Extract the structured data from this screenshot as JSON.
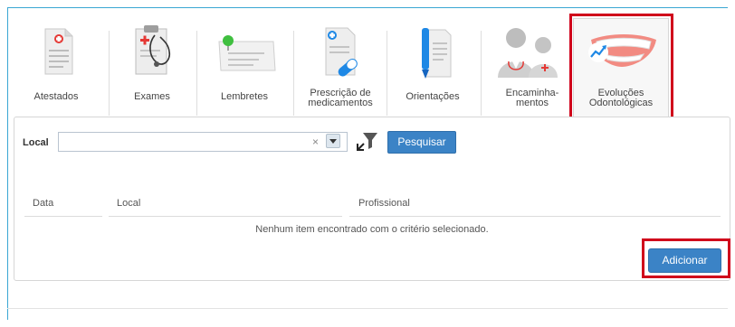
{
  "tabs": {
    "atestados": "Atestados",
    "exames": "Exames",
    "lembretes": "Lembretes",
    "prescricao_1": "Prescrição de",
    "prescricao_2": "medicamentos",
    "orientacoes": "Orientações",
    "encaminhamentos_1": "Encaminha-",
    "encaminhamentos_2": "mentos",
    "evolucoes_1": "Evoluções",
    "evolucoes_2": "Odontológicas",
    "selected": "Evoluções Odontológicas"
  },
  "filter": {
    "local_label": "Local",
    "local_value": "",
    "clear_symbol": "×",
    "search_button": "Pesquisar"
  },
  "table": {
    "columns": [
      "Data",
      "Local",
      "Profissional"
    ],
    "empty_message": "Nenhum item encontrado com o critério selecionado."
  },
  "actions": {
    "add_button": "Adicionar"
  },
  "colors": {
    "accent": "#3b83c6",
    "frame": "#3aa7d3",
    "highlight": "#d0021b"
  },
  "icons": [
    "document-red-cross-icon",
    "clipboard-stethoscope-icon",
    "sticky-note-pin-icon",
    "prescription-pill-icon",
    "document-pen-icon",
    "doctors-referral-icon",
    "teeth-smile-chart-icon",
    "filter-clear-icon",
    "chevron-down-icon"
  ]
}
